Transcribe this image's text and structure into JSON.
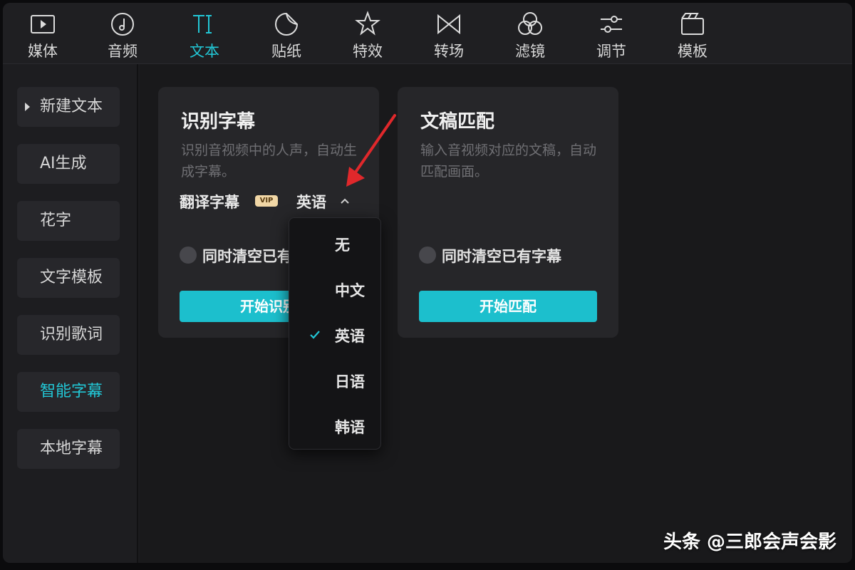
{
  "toolbar": {
    "tabs": [
      {
        "label": "媒体",
        "icon": "media-icon"
      },
      {
        "label": "音频",
        "icon": "audio-icon"
      },
      {
        "label": "文本",
        "icon": "text-icon",
        "active": true
      },
      {
        "label": "贴纸",
        "icon": "sticker-icon"
      },
      {
        "label": "特效",
        "icon": "effects-icon"
      },
      {
        "label": "转场",
        "icon": "transition-icon"
      },
      {
        "label": "滤镜",
        "icon": "filter-icon"
      },
      {
        "label": "调节",
        "icon": "adjust-icon"
      },
      {
        "label": "模板",
        "icon": "template-icon"
      }
    ]
  },
  "sidebar": {
    "items": [
      {
        "label": "新建文本"
      },
      {
        "label": "AI生成"
      },
      {
        "label": "花字"
      },
      {
        "label": "文字模板"
      },
      {
        "label": "识别歌词"
      },
      {
        "label": "智能字幕",
        "active": true
      },
      {
        "label": "本地字幕"
      }
    ]
  },
  "cards": {
    "recognize": {
      "title": "识别字幕",
      "desc": "识别音视频中的人声，自动生成字幕。",
      "translate_label": "翻译字幕",
      "vip": "VIP",
      "selected_language": "英语",
      "clear_label": "同时清空已有字幕",
      "button": "开始识别"
    },
    "match": {
      "title": "文稿匹配",
      "desc": "输入音视频对应的文稿，自动匹配画面。",
      "clear_label": "同时清空已有字幕",
      "button": "开始匹配"
    }
  },
  "dropdown": {
    "options": [
      "无",
      "中文",
      "英语",
      "日语",
      "韩语"
    ],
    "selected": "英语"
  },
  "watermark": "头条 @三郎会声会影",
  "colors": {
    "accent": "#1cbfcd",
    "annotation": "#e0282b"
  }
}
